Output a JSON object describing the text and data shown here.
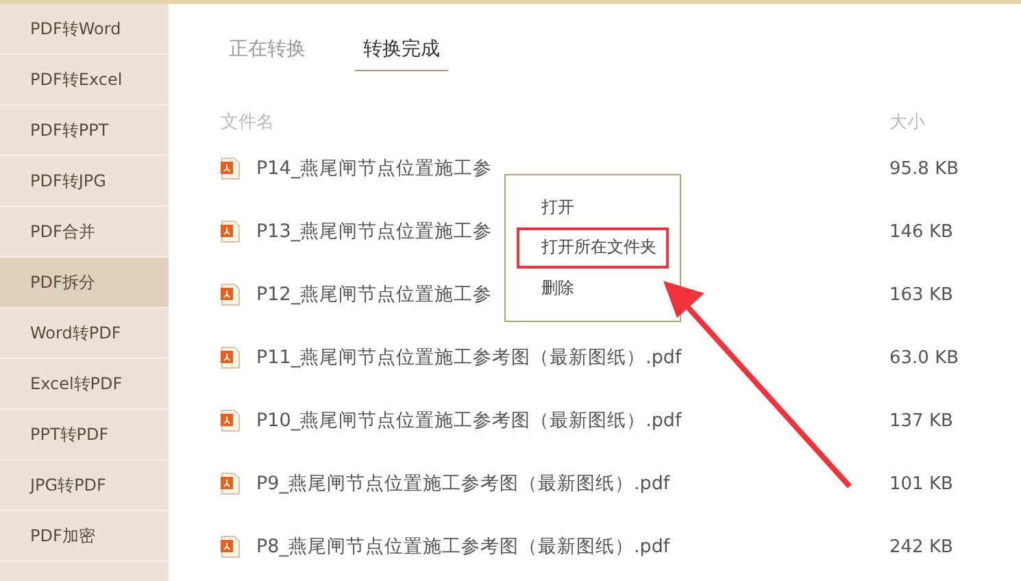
{
  "sidebar": {
    "items": [
      {
        "label": "PDF转Word",
        "selected": false
      },
      {
        "label": "PDF转Excel",
        "selected": false
      },
      {
        "label": "PDF转PPT",
        "selected": false
      },
      {
        "label": "PDF转JPG",
        "selected": false
      },
      {
        "label": "PDF合并",
        "selected": false
      },
      {
        "label": "PDF拆分",
        "selected": true
      },
      {
        "label": "Word转PDF",
        "selected": false
      },
      {
        "label": "Excel转PDF",
        "selected": false
      },
      {
        "label": "PPT转PDF",
        "selected": false
      },
      {
        "label": "JPG转PDF",
        "selected": false
      },
      {
        "label": "PDF加密",
        "selected": false
      }
    ]
  },
  "tabs": [
    {
      "label": "正在转换",
      "selected": false
    },
    {
      "label": "转换完成",
      "selected": true
    }
  ],
  "table": {
    "columns": [
      "文件名",
      "大小"
    ],
    "rows": [
      {
        "name": "P14_燕尾闸节点位置施工参",
        "size": "95.8 KB"
      },
      {
        "name": "P13_燕尾闸节点位置施工参",
        "size": "146 KB"
      },
      {
        "name": "P12_燕尾闸节点位置施工参",
        "size": "163 KB"
      },
      {
        "name": "P11_燕尾闸节点位置施工参考图（最新图纸）.pdf",
        "size": "63.0 KB"
      },
      {
        "name": "P10_燕尾闸节点位置施工参考图（最新图纸）.pdf",
        "size": "137 KB"
      },
      {
        "name": "P9_燕尾闸节点位置施工参考图（最新图纸）.pdf",
        "size": "101 KB"
      },
      {
        "name": "P8_燕尾闸节点位置施工参考图（最新图纸）.pdf",
        "size": "242 KB"
      }
    ]
  },
  "context_menu": {
    "items": [
      {
        "label": "打开",
        "highlighted": false
      },
      {
        "label": "打开所在文件夹",
        "highlighted": true
      },
      {
        "label": "删除",
        "highlighted": false
      }
    ]
  }
}
